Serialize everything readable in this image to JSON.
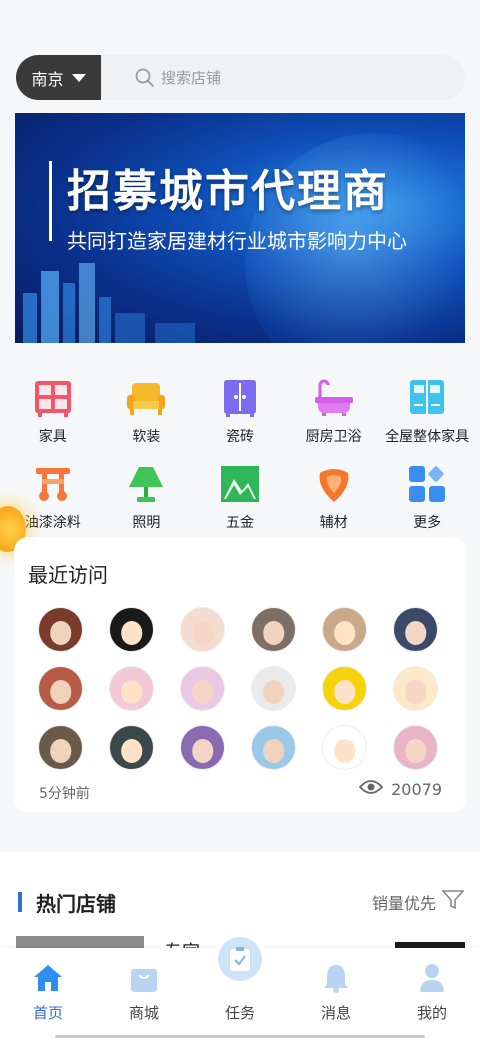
{
  "search": {
    "city": "南京",
    "placeholder": "搜索店铺",
    "search_icon": "search-icon",
    "dropdown_icon": "caret-down-icon"
  },
  "banner": {
    "title": "招募城市代理商",
    "subtitle": "共同打造家居建材行业城市影响力中心"
  },
  "categories": [
    {
      "label": "家具",
      "icon": "cabinet-icon",
      "color": "#f2566a"
    },
    {
      "label": "软装",
      "icon": "sofa-icon",
      "color": "#f7b82a"
    },
    {
      "label": "瓷砖",
      "icon": "tile-icon",
      "color": "#7b6cf0"
    },
    {
      "label": "厨房卫浴",
      "icon": "bathtub-icon",
      "color": "#d35ee8"
    },
    {
      "label": "全屋整体家具",
      "icon": "wardrobe-icon",
      "color": "#3ec3f0"
    },
    {
      "label": "油漆涂料",
      "icon": "paint-icon",
      "color": "#f7773a"
    },
    {
      "label": "照明",
      "icon": "lamp-icon",
      "color": "#3fc458"
    },
    {
      "label": "五金",
      "icon": "hardware-icon",
      "color": "#2fb55a"
    },
    {
      "label": "辅材",
      "icon": "material-icon",
      "color": "#f7772a"
    },
    {
      "label": "更多",
      "icon": "more-icon",
      "color": "#3a8ef0"
    }
  ],
  "recent": {
    "title": "最近访问",
    "time": "5分钟前",
    "views": "20079",
    "view_icon": "eye-icon",
    "avatar_colors": [
      "#7a3b2a",
      "#1a1a1a",
      "#f4dcd0",
      "#7d6f68",
      "#c9a98a",
      "#3c4a6a",
      "#b85a48",
      "#f3c8d6",
      "#e8c8e4",
      "#eaeaea",
      "#f5d20a",
      "#fbe9c8",
      "#6a5a4a",
      "#3a4a4a",
      "#8a6ab0",
      "#9ac8e8",
      "#ffffff",
      "#e8b4c8"
    ]
  },
  "hot": {
    "title": "热门店铺",
    "sort": "销量优先",
    "filter_icon": "filter-icon",
    "shop_name": "专家"
  },
  "nav": {
    "home": "首页",
    "mall": "商城",
    "task": "任务",
    "messages": "消息",
    "mine": "我的"
  }
}
